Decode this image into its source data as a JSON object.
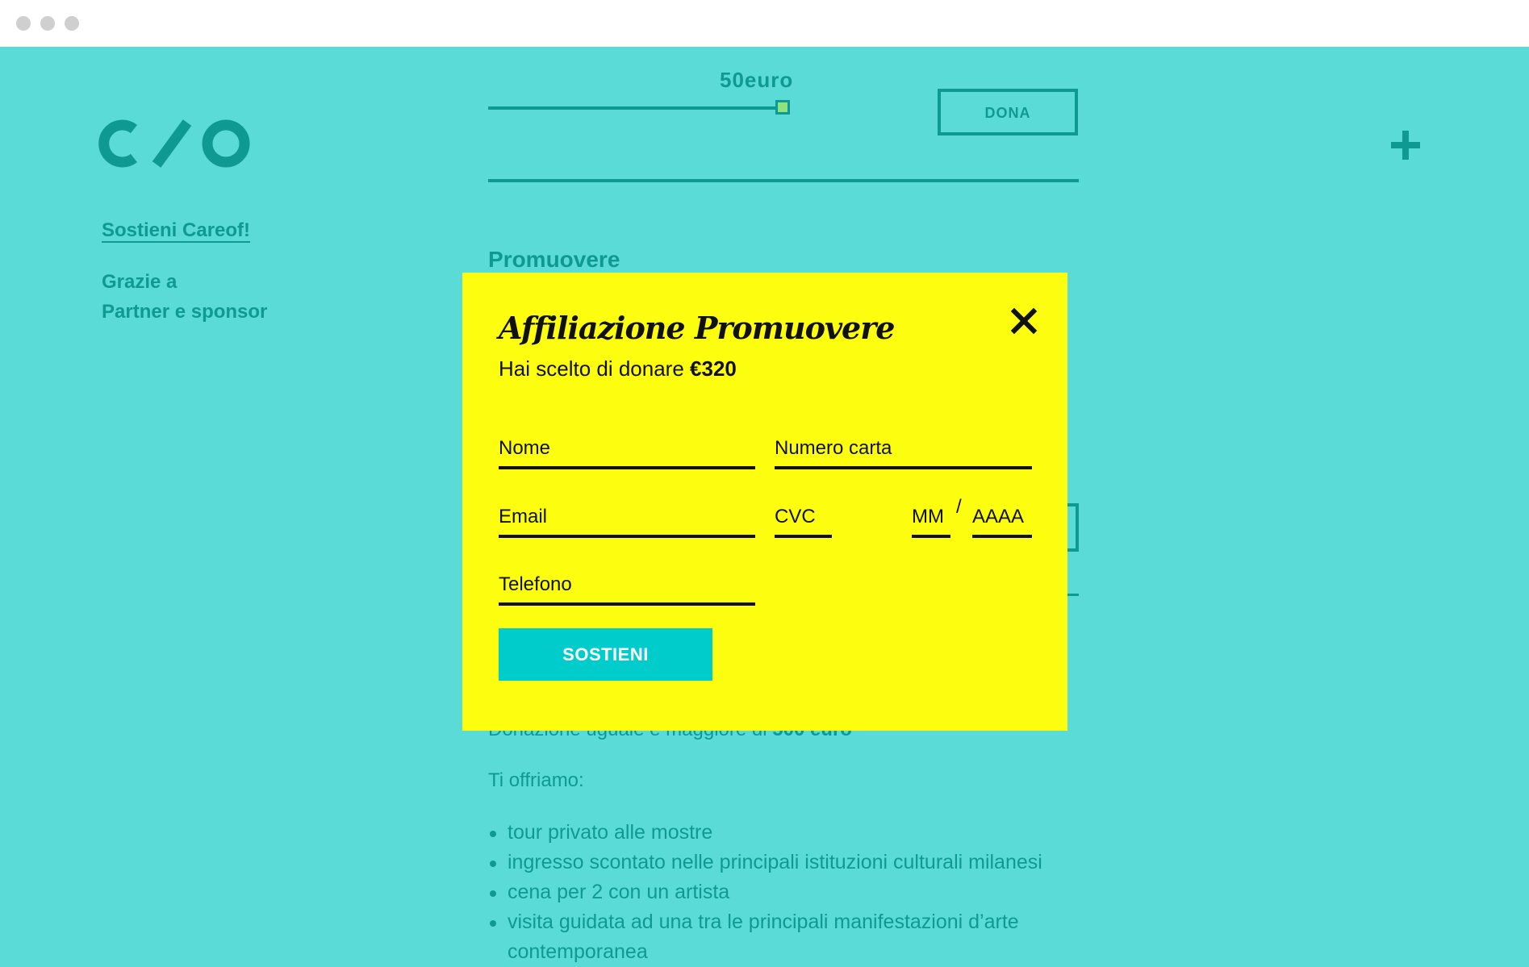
{
  "browser": {
    "controls": [
      "dot",
      "dot",
      "dot"
    ]
  },
  "header": {
    "logo_text": "C/O",
    "amount_label": "50euro",
    "slider": {
      "value_fraction": 0.96
    },
    "donate_button": "DONA",
    "menu_icon": "plus-icon"
  },
  "sidebar": {
    "items": [
      {
        "label": "Sostieni Careof!",
        "active": true
      },
      {
        "label": "Grazie a",
        "active": false
      },
      {
        "label": "Partner e sponsor",
        "active": false
      }
    ]
  },
  "main": {
    "section_title": "Promuovere",
    "donation_text_prefix": "Donazione uguale e maggiore di ",
    "donation_text_amount": "500 euro",
    "offer_intro": "Ti offriamo:",
    "benefits": [
      "tour privato alle mostre",
      "ingresso scontato nelle principali istituzioni culturali milanesi",
      "cena per 2 con un artista",
      "visita guidata ad una tra le principali manifestazioni d’arte contemporanea"
    ]
  },
  "modal": {
    "title": "Affiliazione Promuovere",
    "subtitle_prefix": "Hai scelto di donare ",
    "subtitle_amount": "€320",
    "close_icon": "close-icon",
    "fields": {
      "name": "Nome",
      "card_number": "Numero carta",
      "email": "Email",
      "cvc": "CVC",
      "month": "MM",
      "separator": "/",
      "year": "AAAA",
      "phone": "Telefono"
    },
    "submit_label": "SOSTIENI"
  },
  "colors": {
    "background": "#5bdbd8",
    "primary": "#0e9a93",
    "modal_background": "#fdfd0f",
    "button": "#00cdcb"
  }
}
